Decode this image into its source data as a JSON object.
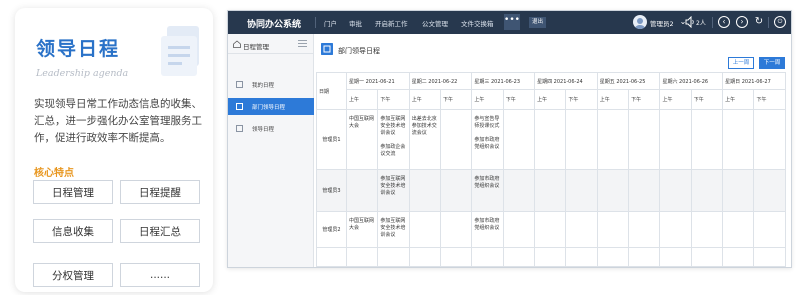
{
  "card": {
    "title": "领导日程",
    "subtitle": "Leadership agenda",
    "description": "实现领导日常工作动态信息的收集、汇总，进一步强化办公室管理服务工作，促进行政效率不断提高。",
    "features_heading": "核心特点",
    "features": [
      "日程管理",
      "日程提醒",
      "信息收集",
      "日程汇总",
      "分权管理",
      "......"
    ]
  },
  "app": {
    "brand": "协同办公系统",
    "nav": [
      "门户",
      "审批",
      "开启新工作",
      "公文管理",
      "文件交换箱"
    ],
    "more_label": "•••",
    "exit_label": "退出",
    "user_name": "管理员2",
    "online_count": "2人",
    "colors": {
      "topbar": "#27384e",
      "accent": "#2d7ad8"
    },
    "sidebar": {
      "header": "日程管理",
      "items": [
        {
          "label": "我的日程",
          "active": false
        },
        {
          "label": "部门领导日程",
          "active": true
        },
        {
          "label": "领导日程",
          "active": false
        }
      ]
    },
    "main": {
      "title": "部门领导日程",
      "prev_label": "上一周",
      "next_label": "下一周",
      "table": {
        "row_header": "日期",
        "days": [
          "星期一 2021-06-21",
          "星期二 2021-06-22",
          "星期三 2021-06-23",
          "星期四 2021-06-24",
          "星期五 2021-06-25",
          "星期六 2021-06-26",
          "星期日 2021-06-27"
        ],
        "am_label": "上午",
        "pm_label": "下午",
        "rows": [
          {
            "name": "管理员1",
            "cells": [
              [
                "中国互联网大会"
              ],
              [
                "参加互联网安全技术培训会议",
                "参加政企会议交流"
              ],
              [
                "出差去北京参加技术交流会议"
              ],
              [],
              [
                "参与宣告导师授课仪式",
                "参加市政府党组织会议"
              ],
              [],
              [],
              [],
              [],
              [],
              [],
              [],
              [],
              []
            ]
          },
          {
            "name": "管理员3",
            "cells": [
              [],
              [
                "参加互联网安全技术培训会议"
              ],
              [],
              [],
              [
                "参加市政府党组织会议"
              ],
              [],
              [],
              [],
              [],
              [],
              [],
              [],
              [],
              []
            ]
          },
          {
            "name": "管理员2",
            "cells": [
              [
                "中国互联网大会"
              ],
              [
                "参加互联网安全技术培训会议"
              ],
              [],
              [],
              [
                "参加市政府党组织会议"
              ],
              [],
              [],
              [],
              [],
              [],
              [],
              [],
              [],
              []
            ]
          },
          {
            "name": "",
            "cells": [
              [],
              [],
              [],
              [],
              [],
              [],
              [],
              [],
              [],
              [],
              [],
              [],
              [],
              []
            ]
          }
        ]
      }
    }
  }
}
